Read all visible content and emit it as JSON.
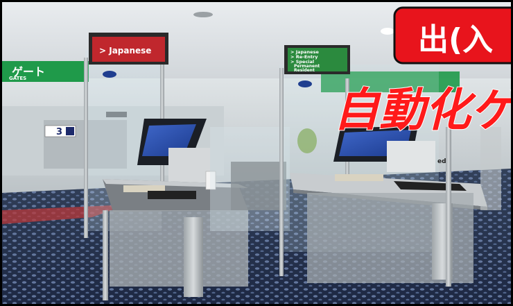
{
  "overlay": {
    "banner_text": "出(入",
    "title_text": "自動化ゲー",
    "banner_color": "#e8141c",
    "title_color": "#ff1a1a"
  },
  "signs": {
    "left_gate_sign": "> Japanese",
    "right_gate_lines": [
      "> Japanese",
      "> Re-Entry",
      "> Special",
      "Permanent",
      "Resident"
    ],
    "overhead_left_text": "ゲート",
    "overhead_left_sub": "GATES",
    "gate_number": "3",
    "partial_sign": "ed"
  },
  "icons": {
    "kiosk": "kiosk-screen-icon",
    "hand_sanitizer": "sanitizer-bottle-icon"
  }
}
